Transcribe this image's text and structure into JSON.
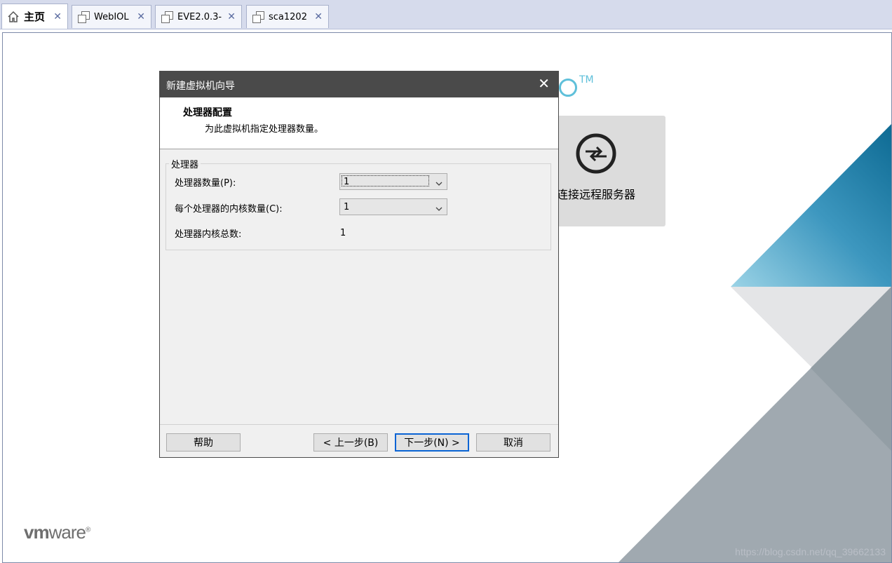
{
  "tabs": [
    {
      "label": "主页",
      "icon": "home-icon",
      "active": true
    },
    {
      "label": "WebIOL",
      "icon": "vm-icon",
      "active": false
    },
    {
      "label": "EVE2.0.3-",
      "icon": "vm-icon",
      "active": false
    },
    {
      "label": "sca1202",
      "icon": "vm-icon",
      "active": false
    }
  ],
  "tab_close_glyph": "✕",
  "home": {
    "brand_tm": "TM",
    "remote_card_label": "连接远程服务器",
    "logo_vm": "vm",
    "logo_ware": "ware",
    "logo_reg": "®",
    "watermark": "https://blog.csdn.net/qq_39662133"
  },
  "dialog": {
    "title": "新建虚拟机向导",
    "close_glyph": "✕",
    "header_title": "处理器配置",
    "header_subtitle": "为此虚拟机指定处理器数量。",
    "group_label": "处理器",
    "processor_count_label": "处理器数量(P):",
    "processor_count_value": "1",
    "cores_per_processor_label": "每个处理器的内核数量(C):",
    "cores_per_processor_value": "1",
    "total_cores_label": "处理器内核总数:",
    "total_cores_value": "1",
    "buttons": {
      "help": "帮助",
      "back": "< 上一步(B)",
      "next": "下一步(N) >",
      "cancel": "取消"
    }
  },
  "colors": {
    "tabbar_bg": "#d6dbec",
    "dialog_titlebar": "#4a4a4a",
    "accent_blue": "#0a64d4",
    "brand_cyan": "#5fc0da"
  }
}
